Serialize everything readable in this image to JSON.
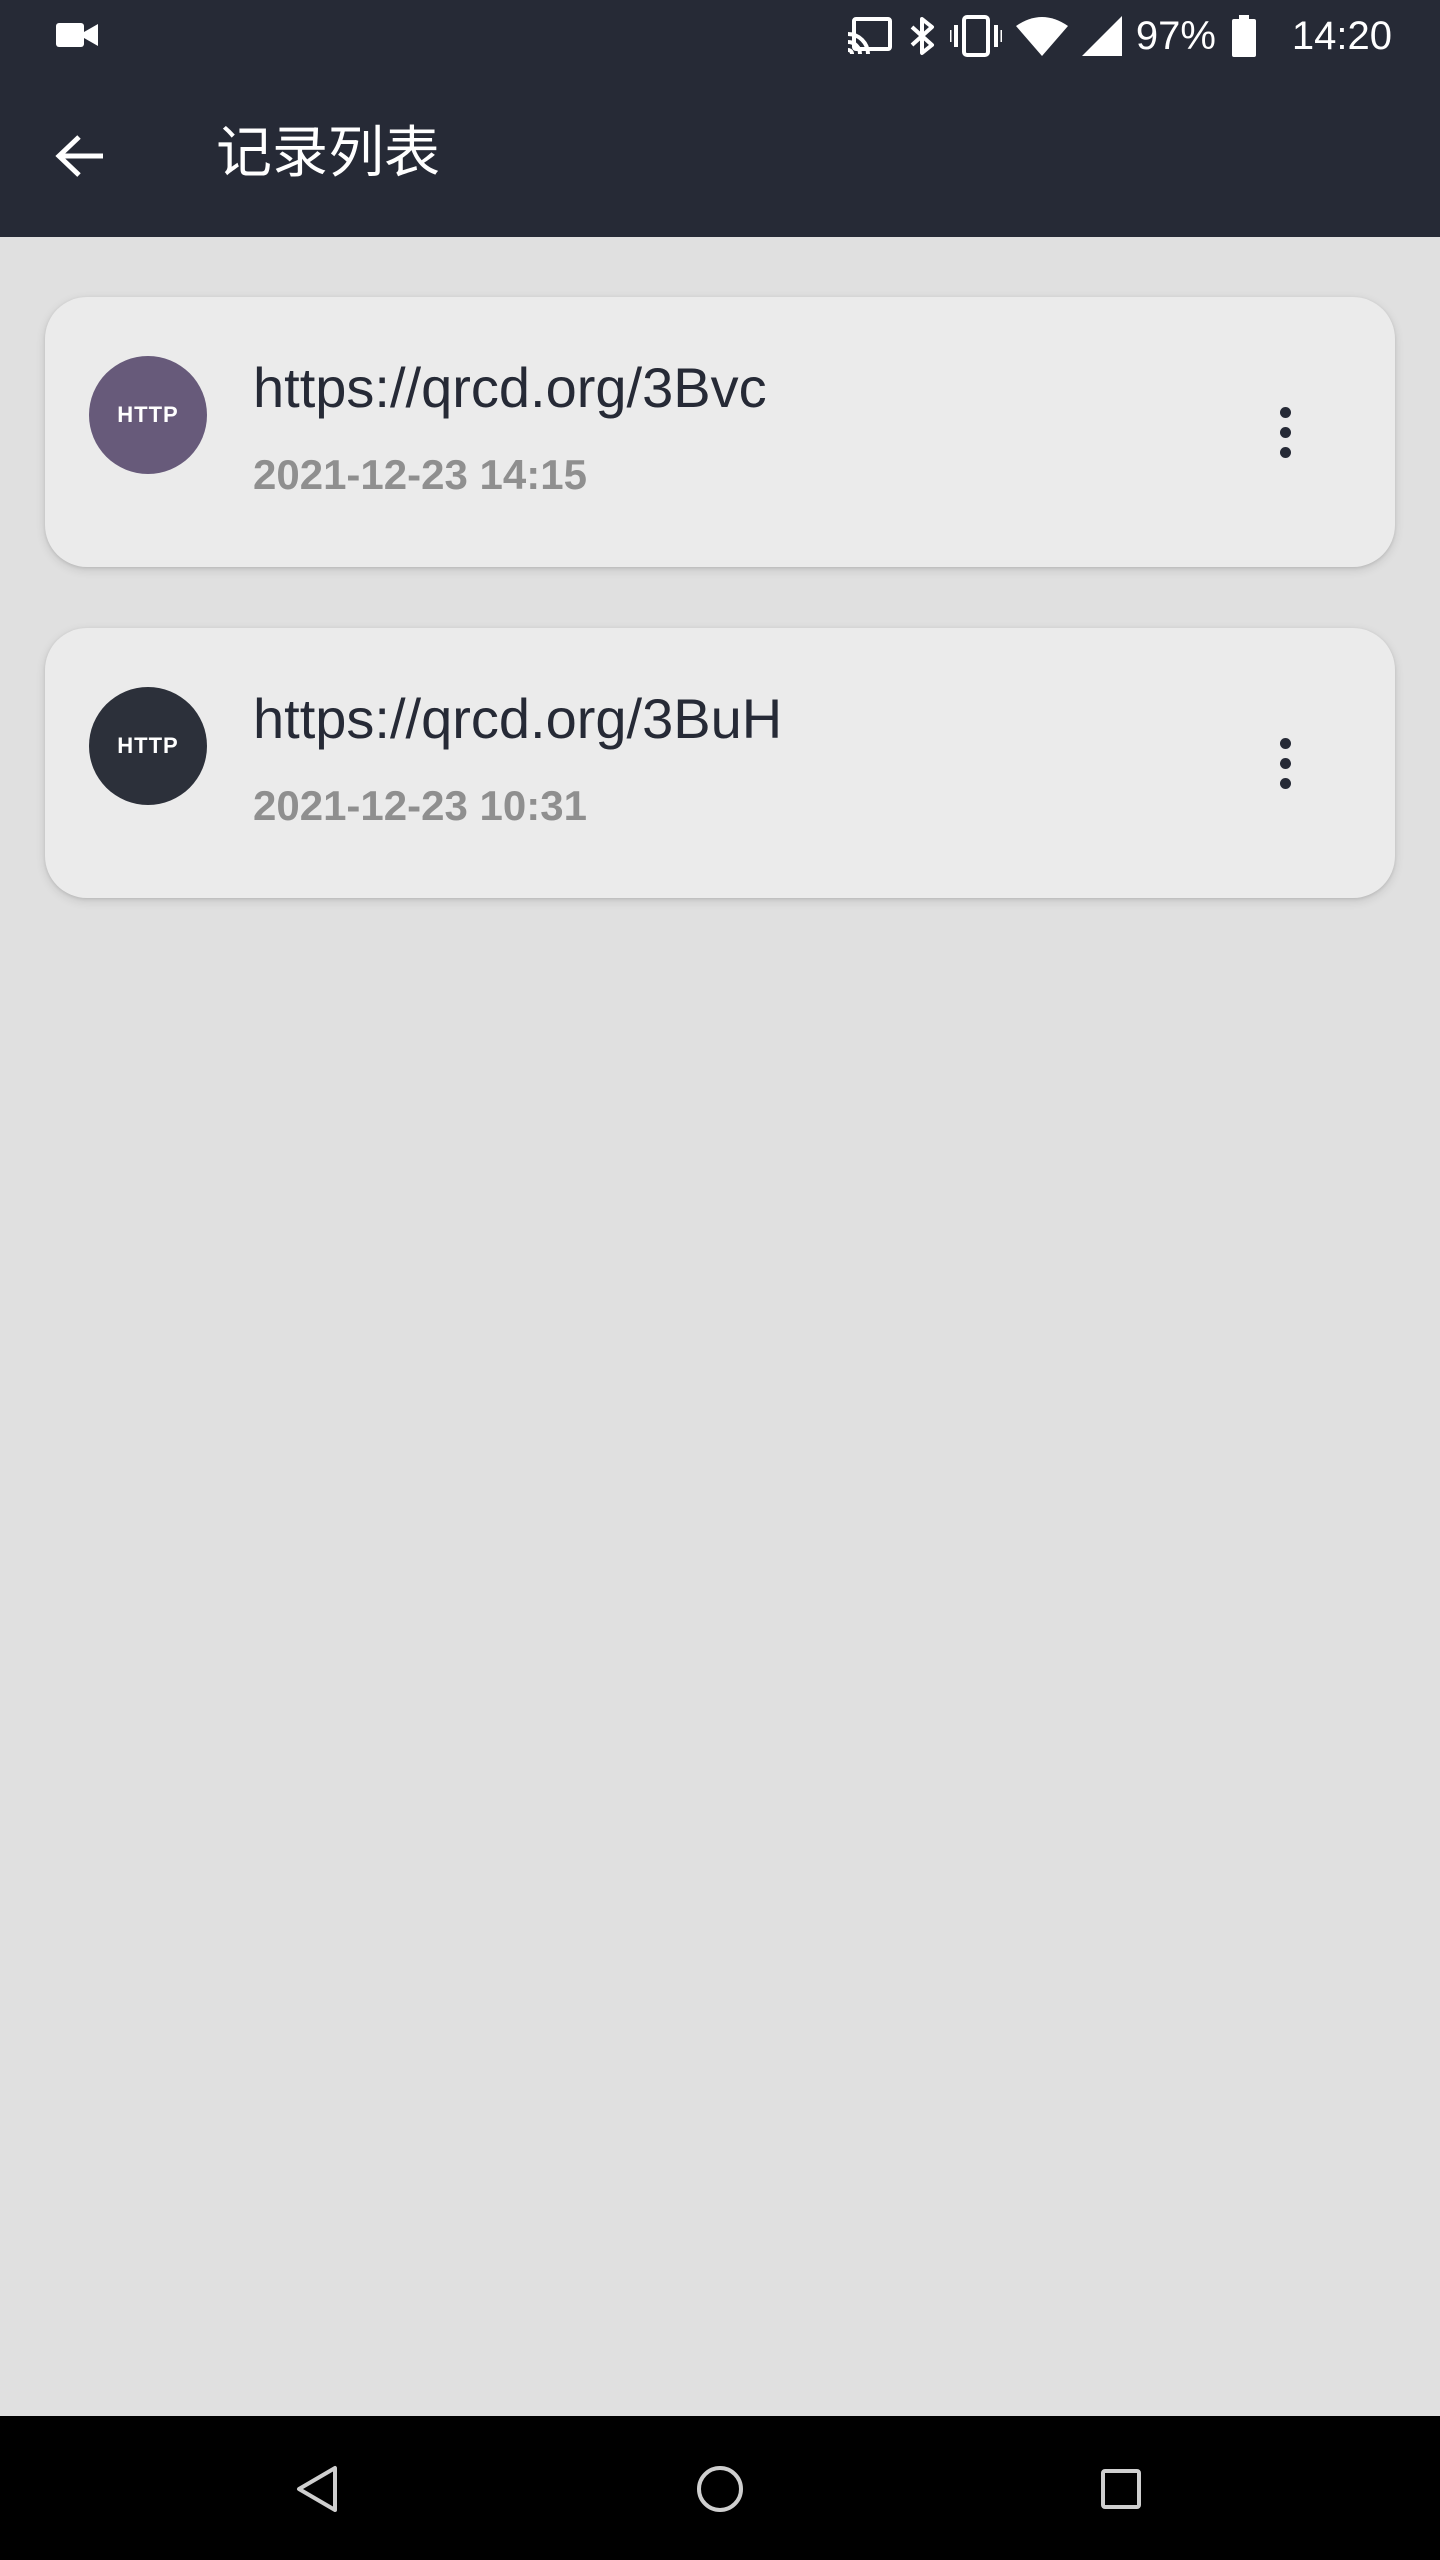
{
  "status_bar": {
    "icons": [
      "video-record-icon",
      "cast-icon",
      "bluetooth-icon",
      "vibrate-icon",
      "wifi-icon",
      "cellular-signal-icon",
      "battery-icon"
    ],
    "battery_percent": "97%",
    "time": "14:20"
  },
  "app_bar": {
    "back_icon": "arrow-back-icon",
    "title": "记录列表"
  },
  "records": [
    {
      "badge": "HTTP",
      "badge_color": "#675a7a",
      "url": "https://qrcd.org/3Bvc",
      "date": "2021-12-23 14:15",
      "menu_icon": "more-vert-icon"
    },
    {
      "badge": "HTTP",
      "badge_color": "#2c303a",
      "url": "https://qrcd.org/3BuH",
      "date": "2021-12-23 10:31",
      "menu_icon": "more-vert-icon"
    }
  ],
  "nav_bar": {
    "icons": [
      "nav-back-icon",
      "nav-home-icon",
      "nav-recents-icon"
    ]
  },
  "colors": {
    "app_bar": "#262a36",
    "background": "#e0e0e0",
    "card": "#ebebeb"
  }
}
